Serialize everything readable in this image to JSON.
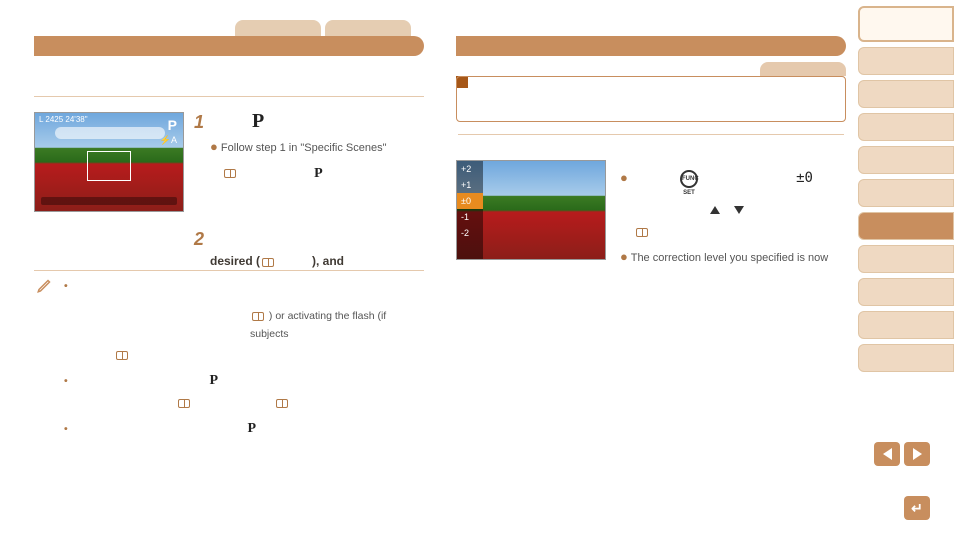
{
  "leftHeader": {
    "title": ""
  },
  "rightHeader": {
    "title": ""
  },
  "screen1": {
    "topLeft": "L 2425   24'38\"",
    "pBadge": "P",
    "flash": "⚡A"
  },
  "step1": {
    "num": "1",
    "modeGlyph": "P",
    "line1": "Follow step 1 in \"Specific Scenes\"",
    "inlineP": "P"
  },
  "step2": {
    "num": "2",
    "boldPart1": "desired (",
    "boldPart2": "), and"
  },
  "notes": {
    "line1_part2": ") or activating the flash (if subjects",
    "line2_p": "P",
    "line3_p": "P"
  },
  "screen2": {
    "scale": [
      "+2",
      "+1",
      "±0",
      "-1",
      "-2"
    ],
    "activeIndex": 2
  },
  "rightInstr": {
    "funcLabel": "FUNC SET",
    "pm0": "±0",
    "line3": "The correction level you specified is now"
  },
  "pager": {
    "prev": "prev",
    "next": "next",
    "back": "return"
  }
}
